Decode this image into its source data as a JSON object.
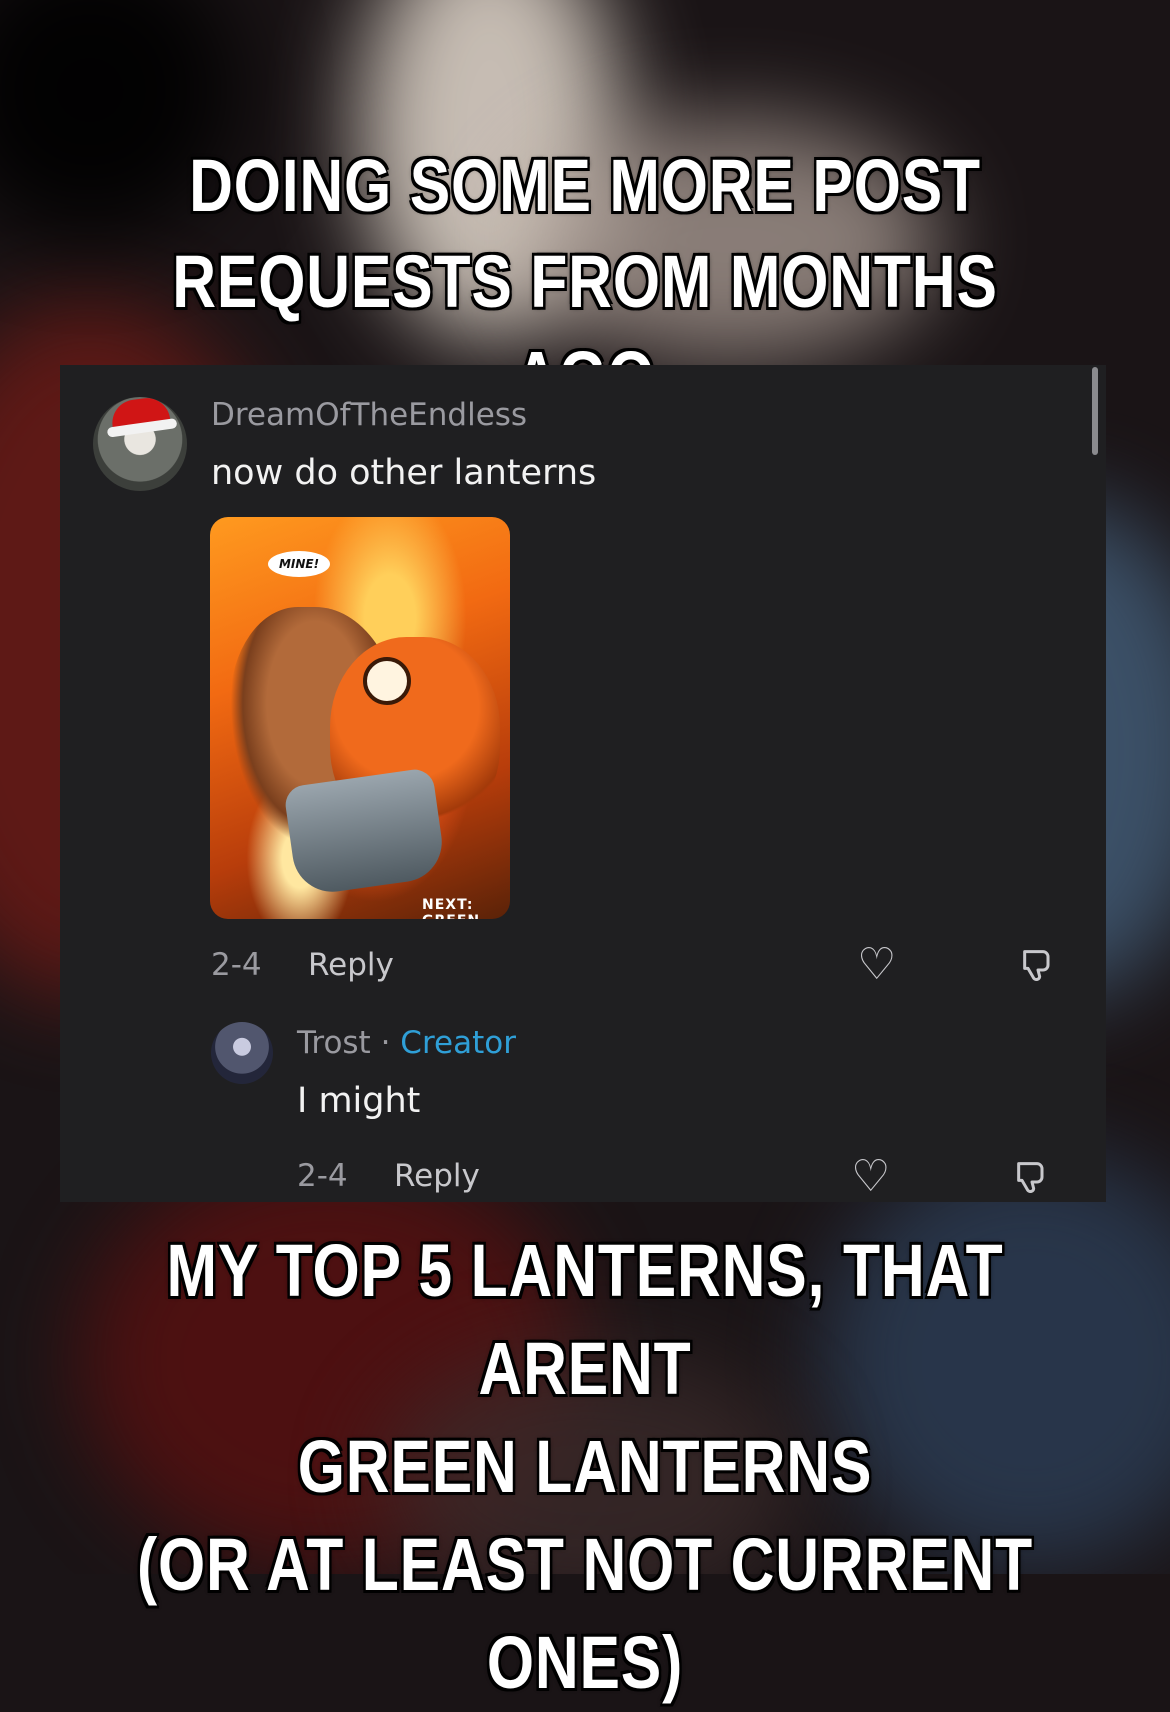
{
  "meme": {
    "top_caption_line1": "Doing some more post",
    "top_caption_line2": "requests from months ago",
    "bottom_caption_line1": "My top 5 lanterns, that arent",
    "bottom_caption_line2": "green lanterns",
    "bottom_caption_line3": "(or at least not current ones)"
  },
  "comment": {
    "username": "DreamOfTheEndless",
    "text": "now do other lanterns",
    "image_caption": "MINE!",
    "image_footer": "NEXT: GREEN",
    "date": "2-4",
    "reply_label": "Reply"
  },
  "reply": {
    "username": "Trost",
    "separator": "·",
    "badge": "Creator",
    "text": "I might",
    "date": "2-4",
    "reply_label": "Reply"
  },
  "icons": {
    "like": "heart-outline-icon",
    "dislike": "thumbs-down-icon"
  },
  "colors": {
    "card_bg": "#1f1f21",
    "creator_badge": "#2f9fd7",
    "muted_text": "#9a9aa0"
  }
}
